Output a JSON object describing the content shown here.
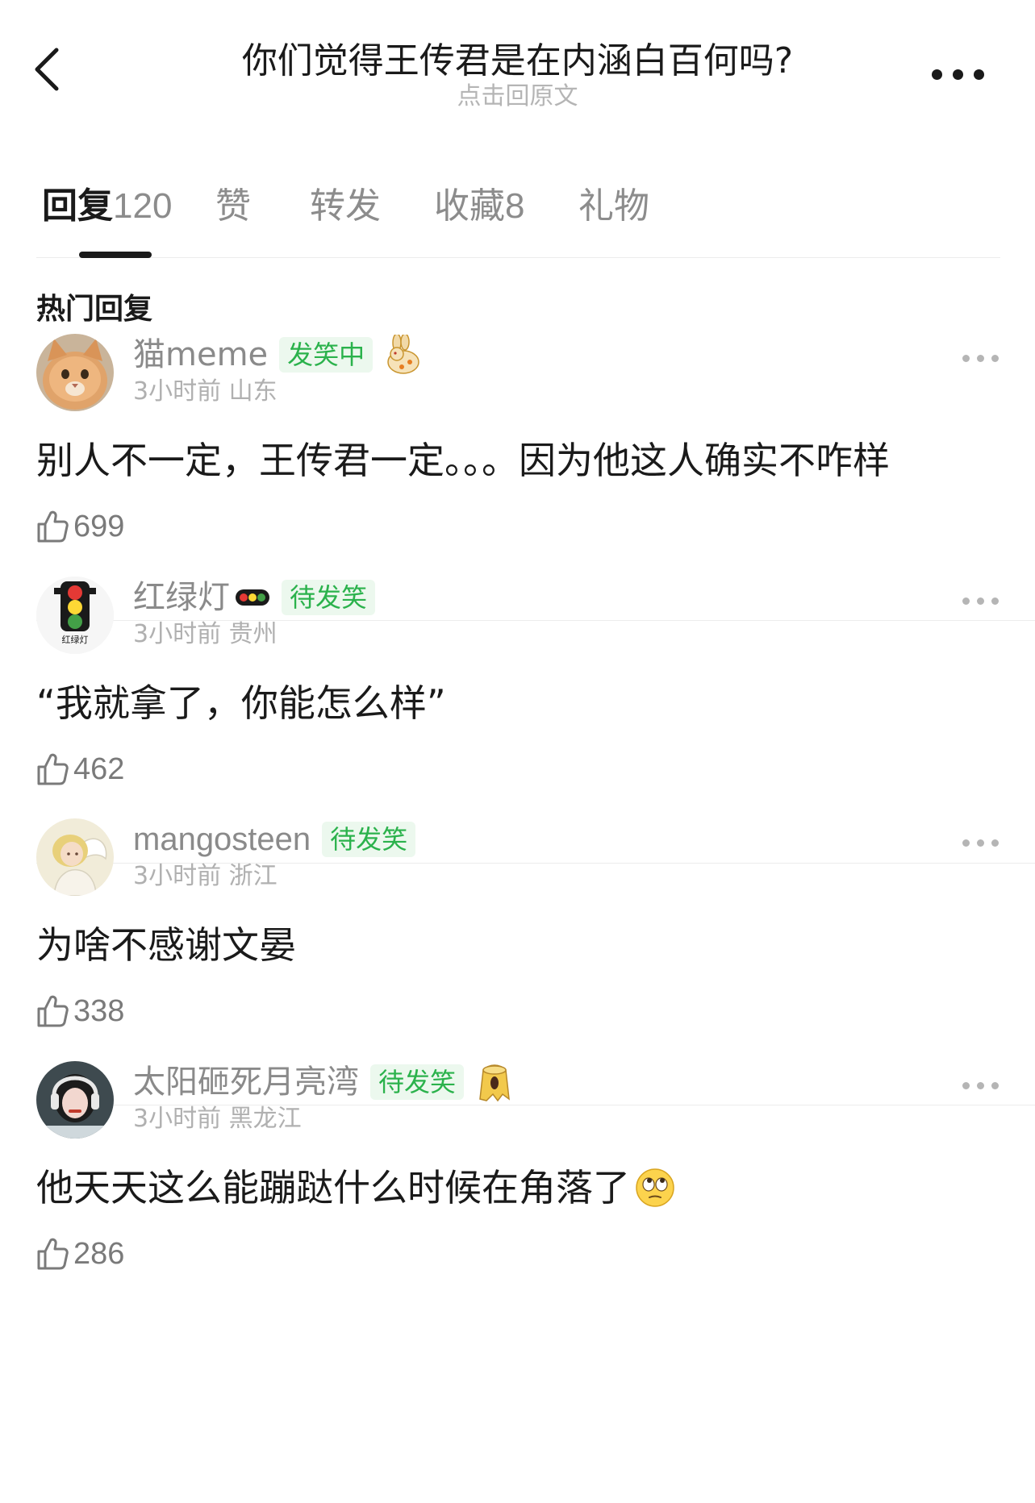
{
  "header": {
    "title": "你们觉得王传君是在内涵白百何吗?",
    "subtitle": "点击回原文"
  },
  "tabs": [
    {
      "label": "回复",
      "count": "120",
      "active": true
    },
    {
      "label": "赞",
      "count": "",
      "active": false
    },
    {
      "label": "转发",
      "count": "",
      "active": false
    },
    {
      "label": "收藏",
      "count": "8",
      "active": false
    },
    {
      "label": "礼物",
      "count": "",
      "active": false
    }
  ],
  "section_title": "热门回复",
  "comments": [
    {
      "username": "猫meme",
      "badge": "发笑中",
      "meta": "3小时前 山东",
      "text": "别人不一定，王传君一定。。。因为他这人确实不咋样",
      "likes": "699",
      "avatar_icon": "cat-face-icon",
      "flair_icon": "rabbit-icon"
    },
    {
      "username": "红绿灯",
      "badge": "待发笑",
      "meta": "3小时前 贵州",
      "text": "“我就拿了，你能怎么样”",
      "likes": "462",
      "avatar_icon": "traffic-light-icon",
      "avatar_caption": "红绿灯",
      "flair_icon": "traffic-light-flair-icon"
    },
    {
      "username": "mangosteen",
      "badge": "待发笑",
      "meta": "3小时前 浙江",
      "text": "为啥不感谢文晏",
      "likes": "338",
      "avatar_icon": "angel-girl-icon"
    },
    {
      "username": "太阳砸死月亮湾",
      "badge": "待发笑",
      "meta": "3小时前 黑龙江",
      "text": "他天天这么能蹦跶什么时候在角落了",
      "likes": "286",
      "avatar_icon": "girl-headphones-icon",
      "flair_icon": "stump-icon",
      "emoji": "eye-roll-emoji-icon"
    }
  ],
  "colors": {
    "badge_green": "#2bb24c",
    "badge_bg": "#ecf8ee",
    "muted": "#8a8a8a"
  }
}
